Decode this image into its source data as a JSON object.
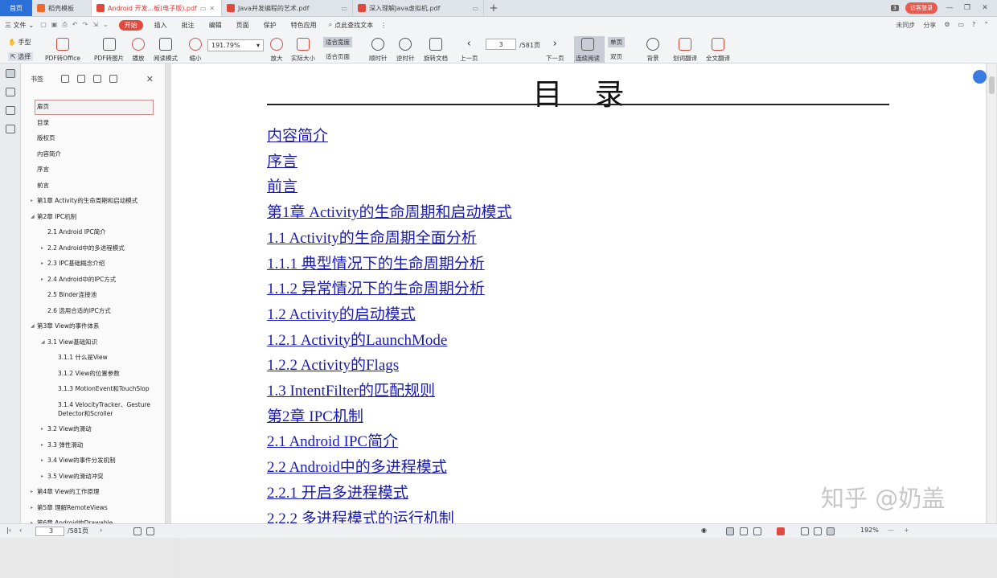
{
  "tabs": {
    "home": "首页",
    "items": [
      {
        "label": "稻壳模板",
        "active": false
      },
      {
        "label": "Android 开发...板(电子版).pdf",
        "active": true
      },
      {
        "label": "Java并发编程的艺术.pdf",
        "active": false
      },
      {
        "label": "深入理解Java虚拟机.pdf",
        "active": false
      }
    ],
    "add": "+",
    "count_badge": "3",
    "login": "访客登录"
  },
  "menu": {
    "file": "三 文件",
    "start": "开始",
    "items": [
      "插入",
      "批注",
      "编辑",
      "页面",
      "保护",
      "特色应用"
    ],
    "search": "点此查找文本",
    "right": [
      "未同步",
      "分享"
    ]
  },
  "toolbar": {
    "hand": "手型",
    "select": "选择",
    "buttons": [
      "PDF转Office",
      "PDF转图片",
      "播放",
      "阅读模式",
      "缩小",
      "放大",
      "实际大小",
      "顺时针",
      "逆时针",
      "旋转文档",
      "上一页",
      "下一页",
      "连续阅读",
      "背景",
      "划词翻译",
      "全文翻译"
    ],
    "zoom": "191.79%",
    "fit_width": "适合宽度",
    "fit_page": "适合页面",
    "page_current": "3",
    "page_total": "/581页",
    "single_page": "单页",
    "double_page": "双页"
  },
  "bookmarks": {
    "title": "书签",
    "items": [
      {
        "label": "扉页",
        "level": 0,
        "arrow": false,
        "selected": true
      },
      {
        "label": "目录",
        "level": 0,
        "arrow": false
      },
      {
        "label": "版权页",
        "level": 0,
        "arrow": false
      },
      {
        "label": "内容简介",
        "level": 0,
        "arrow": false
      },
      {
        "label": "序言",
        "level": 0,
        "arrow": false
      },
      {
        "label": "前言",
        "level": 0,
        "arrow": false
      },
      {
        "label": "第1章 Activity的生命周期和启动模式",
        "level": 0,
        "arrow": "right"
      },
      {
        "label": "第2章 IPC机制",
        "level": 0,
        "arrow": "down"
      },
      {
        "label": "2.1 Android IPC简介",
        "level": 1,
        "arrow": false
      },
      {
        "label": "2.2 Android中的多进程模式",
        "level": 1,
        "arrow": "right"
      },
      {
        "label": "2.3 IPC基础概念介绍",
        "level": 1,
        "arrow": "right"
      },
      {
        "label": "2.4 Android中的IPC方式",
        "level": 1,
        "arrow": "right"
      },
      {
        "label": "2.5 Binder连接池",
        "level": 1,
        "arrow": false
      },
      {
        "label": "2.6 选用合适的IPC方式",
        "level": 1,
        "arrow": false
      },
      {
        "label": "第3章 View的事件体系",
        "level": 0,
        "arrow": "down"
      },
      {
        "label": "3.1 View基础知识",
        "level": 1,
        "arrow": "down"
      },
      {
        "label": "3.1.1 什么是View",
        "level": 2,
        "arrow": false
      },
      {
        "label": "3.1.2 View的位置参数",
        "level": 2,
        "arrow": false
      },
      {
        "label": "3.1.3 MotionEvent和TouchSlop",
        "level": 2,
        "arrow": false
      },
      {
        "label": "3.1.4 VelocityTracker、Gesture",
        "label2": "Detector和Scroller",
        "level": 2,
        "arrow": false
      },
      {
        "label": "3.2 View的滑动",
        "level": 1,
        "arrow": "right"
      },
      {
        "label": "3.3 弹性滑动",
        "level": 1,
        "arrow": "right"
      },
      {
        "label": "3.4 View的事件分发机制",
        "level": 1,
        "arrow": "right"
      },
      {
        "label": "3.5 View的滑动冲突",
        "level": 1,
        "arrow": "right"
      },
      {
        "label": "第4章 View的工作原理",
        "level": 0,
        "arrow": "right"
      },
      {
        "label": "第5章 理解RemoteViews",
        "level": 0,
        "arrow": "right"
      },
      {
        "label": "第6章 Android的Drawable",
        "level": 0,
        "arrow": "right"
      }
    ]
  },
  "document": {
    "title": "目录",
    "toc": [
      "内容简介",
      "序言",
      "前言",
      "第1章 Activity的生命周期和启动模式",
      "1.1 Activity的生命周期全面分析",
      "1.1.1 典型情况下的生命周期分析",
      "1.1.2 异常情况下的生命周期分析",
      "1.2 Activity的启动模式",
      "1.2.1 Activity的LaunchMode",
      "1.2.2 Activity的Flags",
      "1.3 IntentFilter的匹配规则",
      "第2章 IPC机制",
      "2.1 Android IPC简介",
      "2.2 Android中的多进程模式",
      "2.2.1 开启多进程模式",
      "2.2.2 多进程模式的运行机制"
    ],
    "watermark": "知乎 @奶盖"
  },
  "status": {
    "page_current": "3",
    "page_total": "/581页",
    "zoom": "192%"
  },
  "colors": {
    "link": "#1a1ab3",
    "accent": "#e04a3f",
    "home_tab": "#2b6fd9"
  }
}
